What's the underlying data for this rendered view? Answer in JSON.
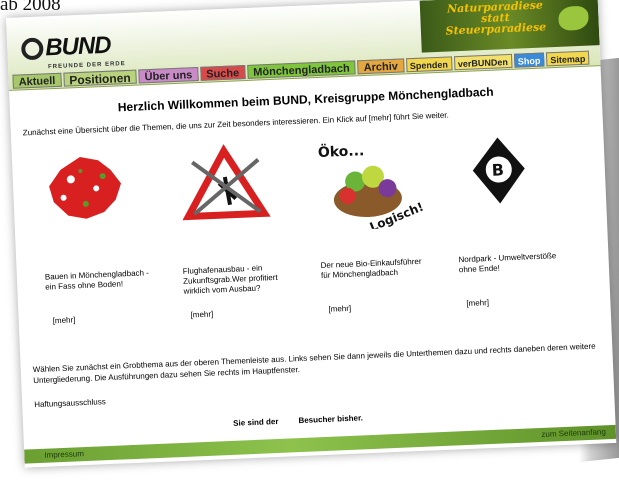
{
  "caption": "ab 2008",
  "logo": {
    "text": "BUND",
    "subtitle": "FREUNDE DER ERDE"
  },
  "banner": {
    "line1": "Naturparadiese",
    "line2": "statt",
    "line3": "Steuerparadiese"
  },
  "nav": {
    "items": [
      {
        "label": "Aktuell",
        "bg": "#a6c86a"
      },
      {
        "label": "Positionen",
        "bg": "#b9d37c"
      },
      {
        "label": "Über uns",
        "bg": "#c98ac8"
      },
      {
        "label": "Suche",
        "bg": "#d84a4a"
      },
      {
        "label": "Mönchengladbach",
        "bg": "#7ec63a"
      },
      {
        "label": "Archiv",
        "bg": "#e4a73f"
      },
      {
        "label": "Spenden",
        "bg": "#f1d54a"
      },
      {
        "label": "verBUNDen",
        "bg": "#f2e06a"
      },
      {
        "label": "Shop",
        "bg": "#3b8ad9"
      },
      {
        "label": "Sitemap",
        "bg": "#f2d84f"
      }
    ]
  },
  "main": {
    "welcome": "Herzlich Willkommen beim BUND, Kreisgruppe Mönchengladbach",
    "intro": "Zunächst eine Übersicht über die Themen, die uns zur Zeit besonders interessieren. Ein Klick auf [mehr] führt Sie weiter.",
    "items": [
      {
        "desc": "Bauen  in Mönchengladbach - ein Fass ohne Boden!",
        "more": "[mehr]"
      },
      {
        "desc": "Flughafenausbau - ein Zukunftsgrab.Wer profitiert wirklich vom Ausbau?",
        "more": "[mehr]"
      },
      {
        "desc": "Der neue Bio-Einkaufsführer für Mönchengladbach",
        "more": "[mehr]"
      },
      {
        "desc": "Nordpark - Umweltverstöße ohne Ende!",
        "more": "[mehr]"
      }
    ],
    "oeko_label": "Öko...",
    "logisch_label": "Logisch!",
    "text1": "Wählen Sie zunächst ein Grobthema aus der oberen Themenleiste aus. Links sehen Sie dann jeweils die Unterthemen dazu und rechts daneben deren weitere Untergliederung. Die Ausführungen dazu sehen Sie rechts im Hauptfenster.",
    "haftung": "Haftungsausschluss",
    "visitor_a": "Sie sind der",
    "visitor_b": "Besucher bisher."
  },
  "footer": {
    "impressum": "Impressum",
    "top": "zum Seitenanfang"
  }
}
